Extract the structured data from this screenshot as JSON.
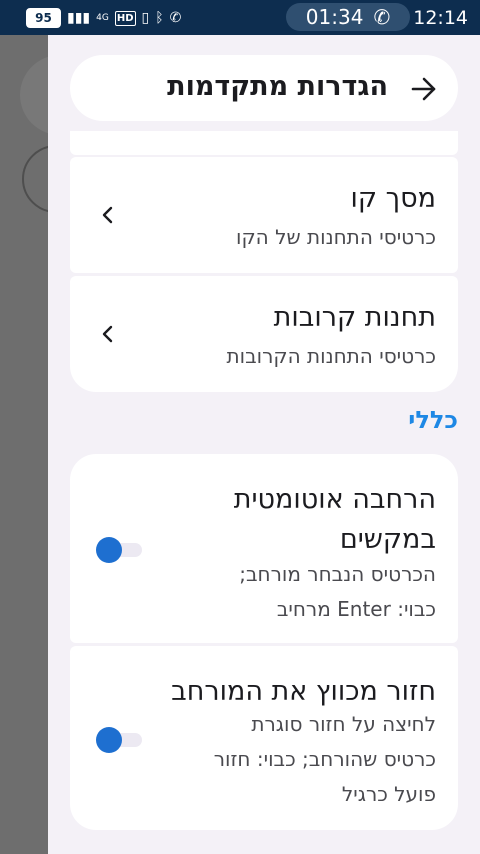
{
  "status": {
    "battery": "95",
    "network": "4G",
    "hd": "HD",
    "call_time": "01:34",
    "time": "12:14"
  },
  "header": {
    "title": "הגדרות מתקדמות",
    "back_icon": "arrow-right-icon"
  },
  "items": [
    {
      "title": "מסך קו",
      "subtitle": "כרטיסי התחנות של הקו"
    },
    {
      "title": "תחנות קרובות",
      "subtitle": "כרטיסי התחנות הקרובות"
    }
  ],
  "section": {
    "label": "כללי"
  },
  "toggles": [
    {
      "title_lines": [
        "הרחבה אוטומטית",
        "במקשים"
      ],
      "subtitle_lines": [
        "הכרטיס הנבחר מורחב;",
        "כבוי: Enter מרחיב"
      ],
      "state": "on"
    },
    {
      "title_lines": [
        "חזור מכווץ את המורחב"
      ],
      "subtitle_lines": [
        "לחיצה על חזור סוגרת",
        "כרטיס שהורחב; כבוי: חזור",
        "פועל כרגיל"
      ],
      "state": "on"
    }
  ],
  "colors": {
    "accent": "#1e88e5",
    "toggle_thumb": "#1e6fd0",
    "statusbar": "#0d2d4f"
  }
}
